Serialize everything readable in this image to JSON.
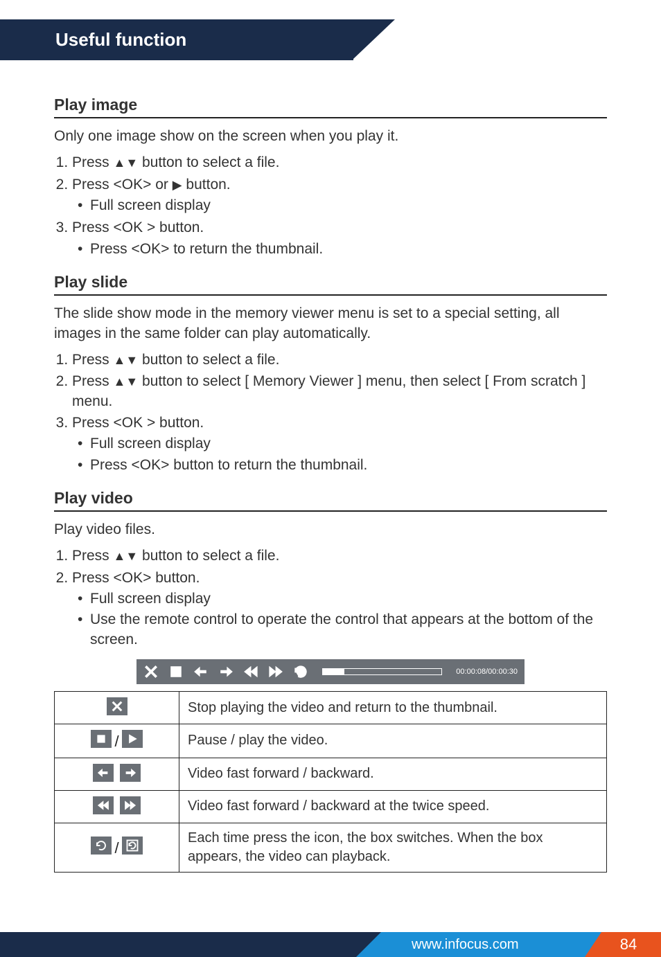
{
  "banner": {
    "title": "Useful function"
  },
  "play_image": {
    "heading": "Play image",
    "desc": "Only one image show on the screen when you play it.",
    "step1_a": "Press ",
    "step1_b": " button to select a file.",
    "step2_a": "Press <OK> or ",
    "step2_b": " button.",
    "step2_bullet1": "Full screen display",
    "step3": " Press <OK > button.",
    "step3_bullet1": "Press <OK> to return the thumbnail."
  },
  "play_slide": {
    "heading": "Play slide",
    "desc": "The slide show mode in the memory viewer menu is set to a special setting, all images in the same folder can play automatically.",
    "step1_a": "Press ",
    "step1_b": " button to select a file.",
    "step2_a": "Press ",
    "step2_b": " button to select [ Memory Viewer ] menu, then select [ From scratch ] menu.",
    "step3": "Press <OK > button.",
    "step3_bullet1": "Full screen display",
    "step3_bullet2": "Press <OK> button to return the thumbnail."
  },
  "play_video": {
    "heading": "Play video",
    "desc": "Play video files.",
    "step1_a": "Press ",
    "step1_b": " button to select a file.",
    "step2": "Press <OK> button.",
    "step2_bullet1": "Full screen display",
    "step2_bullet2": "Use the remote control to operate the control that appears at the bottom of the screen."
  },
  "player": {
    "time": "00:00:08/00:00:30"
  },
  "icon_table": {
    "row1": "Stop playing the video and return to the thumbnail.",
    "row2": "Pause / play the video.",
    "row3": "Video fast forward / backward.",
    "row4": "Video fast forward / backward at the twice speed.",
    "row5": "Each time press the icon, the box switches. When the box appears, the video can playback."
  },
  "footer": {
    "url": "www.infocus.com",
    "page": "84"
  }
}
